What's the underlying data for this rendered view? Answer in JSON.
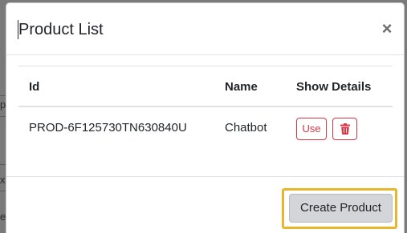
{
  "modal": {
    "title": "Product List",
    "close_label": "×"
  },
  "table": {
    "headers": [
      "Id",
      "Name",
      "Show Details"
    ],
    "rows": [
      {
        "id": "PROD-6F125730TN630840U",
        "name": "Chatbot",
        "use_label": "Use"
      }
    ]
  },
  "footer": {
    "create_label": "Create Product"
  },
  "background": {
    "peek_chars": [
      "p",
      "x",
      "e"
    ]
  },
  "colors": {
    "danger": "#dc3545",
    "highlight": "#e8b62c",
    "secondary_button": "#d3d5d9"
  },
  "icons": {
    "close": "close-icon",
    "delete": "trash-icon"
  }
}
